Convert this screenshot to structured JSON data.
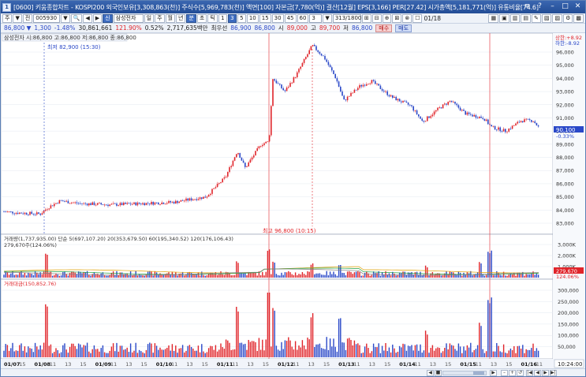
{
  "title_bar": {
    "app_icon": "1",
    "title": "[0600] 키움종합차트 - KOSPI200 외국인보유[3,308,863(천)] 주식수[5,969,783(천)] 액면[100] 자본금[7,780(억)] 결산[12월] EPS[3,166] PER[27.42] 시가총액[5,181,771(억)] 유통비율[74.6]",
    "window_buttons": [
      {
        "name": "menu",
        "glyph": "≡"
      },
      {
        "name": "help",
        "glyph": "?"
      },
      {
        "name": "minimize",
        "glyph": "–"
      },
      {
        "name": "maximize",
        "glyph": "□"
      },
      {
        "name": "close",
        "glyph": "✕"
      }
    ]
  },
  "toolbar": {
    "left_buttons": [
      "주",
      "▼",
      "전"
    ],
    "stock_code": "005930",
    "nav_buttons": [
      "▼",
      "🔍",
      "◀",
      "▶"
    ],
    "stock_name_icon": "신",
    "stock_name": "삼성전자",
    "period_buttons": [
      {
        "label": "일",
        "selected": false
      },
      {
        "label": "주",
        "selected": false
      },
      {
        "label": "월",
        "selected": false
      },
      {
        "label": "년",
        "selected": false
      },
      {
        "label": "분",
        "selected": true
      },
      {
        "label": "초",
        "selected": false
      },
      {
        "label": "틱",
        "selected": false
      }
    ],
    "interval_buttons": [
      {
        "label": "1",
        "selected": false
      },
      {
        "label": "3",
        "selected": true
      },
      {
        "label": "5",
        "selected": false
      },
      {
        "label": "10",
        "selected": false
      },
      {
        "label": "15",
        "selected": false
      },
      {
        "label": "30",
        "selected": false
      },
      {
        "label": "45",
        "selected": false
      },
      {
        "label": "60",
        "selected": false
      }
    ],
    "interval_value": "3",
    "count_value": "313/1800",
    "tool_icons": [
      "⊞",
      "⊟",
      "⊕",
      "⊠",
      "⊗"
    ],
    "checkbox_label": "01/18",
    "right_icons": [
      "▦",
      "▣",
      "▥",
      "▤",
      "✎",
      "▧",
      "▨",
      "⚙",
      "▩"
    ]
  },
  "quote_bar": {
    "price": "86,800 ▼",
    "change": "1,300",
    "change_pct": "-1.48%",
    "volume": "30,861,661",
    "volume_ratio": "121.90%",
    "turnover_pct": "0.52%",
    "trade_amount": "2,717,635백만",
    "best_bid_label": "최우선",
    "ask": "86,900",
    "bid": "86,800",
    "open_label": "시",
    "open": "89,000",
    "high_label": "고",
    "high": "89,700",
    "low_label": "저",
    "low": "86,800",
    "buy_label": "매수",
    "sell_label": "매도"
  },
  "price_panel": {
    "legend": "삼성전자 시:86,800 고:86,800 저:86,800 종:86,800",
    "min_annotation": "최저 82,900 (15:30)",
    "max_annotation": "최고 96,800 (10:15)",
    "upper_limit": "상한:+8.92",
    "lower_limit": "하한:-8.92",
    "current_price": "90,100",
    "current_pct": "-0.33%",
    "y_labels": [
      "96,000",
      "95,000",
      "94,000",
      "93,000",
      "92,000",
      "91,000",
      "90,000",
      "89,000",
      "88,000",
      "87,000",
      "86,000",
      "85,000",
      "84,000",
      "83,000"
    ]
  },
  "volume_panel": {
    "legend": "거래량(1,737,935.00)  단순 5(697,107.20)  20(353,679.50)  60(195,340.52)  120(176,106.43)",
    "sub_legend": "279,670주(124.06%)",
    "y_labels": [
      "3,000K",
      "2,000K",
      "1,000K"
    ],
    "current_value": "279,670",
    "current_pct": "124.06%",
    "colors": {
      "ma5": "#c020c0",
      "ma20": "#e0a000",
      "ma60": "#20a040",
      "ma120": "#808080"
    }
  },
  "amount_panel": {
    "legend": "거래대금(150,852.76)",
    "y_labels": [
      "300,000",
      "250,000",
      "200,000",
      "150,000",
      "100,000",
      "50,000"
    ]
  },
  "x_axis": {
    "labels": [
      "01/07",
      "15",
      "01/08",
      "11",
      "13",
      "15",
      "01/09",
      "11",
      "13",
      "15",
      "01/10",
      "11",
      "13",
      "15",
      "01/11",
      "11",
      "13",
      "15",
      "01/12",
      "11",
      "13",
      "15",
      "01/13",
      "11",
      "13",
      "15",
      "01/14",
      "11",
      "13",
      "15",
      "01/15",
      "11",
      "13",
      "15",
      "01/16",
      "11"
    ],
    "time_box": "10:24:00"
  },
  "colors": {
    "up": "#e0242a",
    "down": "#2a48c8",
    "accent": "#234d96"
  }
}
